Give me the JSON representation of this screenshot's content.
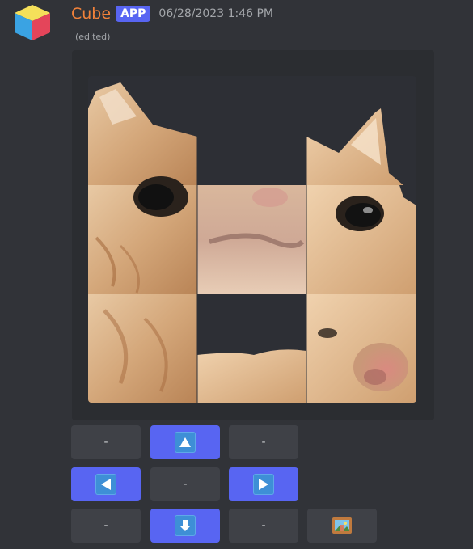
{
  "message": {
    "username": "Cube",
    "badge": "APP",
    "timestamp": "06/28/2023 1:46 PM",
    "edited": "(edited)",
    "username_color": "#f0813a",
    "badge_color": "#5865f2"
  },
  "avatar": {
    "icon": "cube-icon",
    "colors": [
      "#f5e05a",
      "#3aa3e3",
      "#e4455a"
    ]
  },
  "puzzle": {
    "image": "cat-face-sliding-puzzle",
    "grid": "3x3",
    "empty_tiles": [
      "row1-col2",
      "row3-col2"
    ]
  },
  "buttons": {
    "row1": [
      {
        "label": "-",
        "style": "secondary"
      },
      {
        "icon": "up-arrow-icon",
        "style": "primary"
      },
      {
        "label": "-",
        "style": "secondary"
      }
    ],
    "row2": [
      {
        "icon": "left-arrow-icon",
        "style": "primary"
      },
      {
        "label": "-",
        "style": "secondary"
      },
      {
        "icon": "right-arrow-icon",
        "style": "primary"
      }
    ],
    "row3": [
      {
        "label": "-",
        "style": "secondary"
      },
      {
        "icon": "down-arrow-icon",
        "style": "primary"
      },
      {
        "label": "-",
        "style": "secondary"
      },
      {
        "icon": "framed-picture-icon",
        "style": "secondary"
      }
    ]
  }
}
